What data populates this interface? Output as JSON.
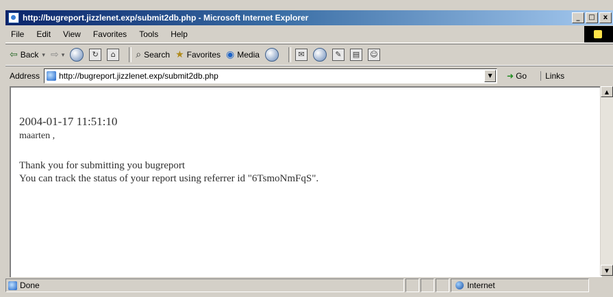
{
  "window": {
    "title": "http://bugreport.jizzlenet.exp/submit2db.php - Microsoft Internet Explorer",
    "controls": {
      "minimize": "_",
      "maximize": "□",
      "close": "x"
    }
  },
  "menu": [
    "File",
    "Edit",
    "View",
    "Favorites",
    "Tools",
    "Help"
  ],
  "toolbar": {
    "back": "Back",
    "search": "Search",
    "favorites": "Favorites",
    "media": "Media"
  },
  "address": {
    "label": "Address",
    "url": "http://bugreport.jizzlenet.exp/submit2db.php",
    "go": "Go",
    "links": "Links"
  },
  "page": {
    "timestamp": "2004-01-17 11:51:10",
    "username": "maarten ,",
    "line1": "Thank you for submitting you bugreport",
    "line2": "You can track the status of your report using referrer id \"6TsmoNmFqS\"."
  },
  "status": {
    "text": "Done",
    "zone": "Internet"
  },
  "icons": {
    "app": "ie-page-icon",
    "throbber": "windows-logo-icon",
    "address_page": "page-icon",
    "zone": "globe-icon"
  }
}
